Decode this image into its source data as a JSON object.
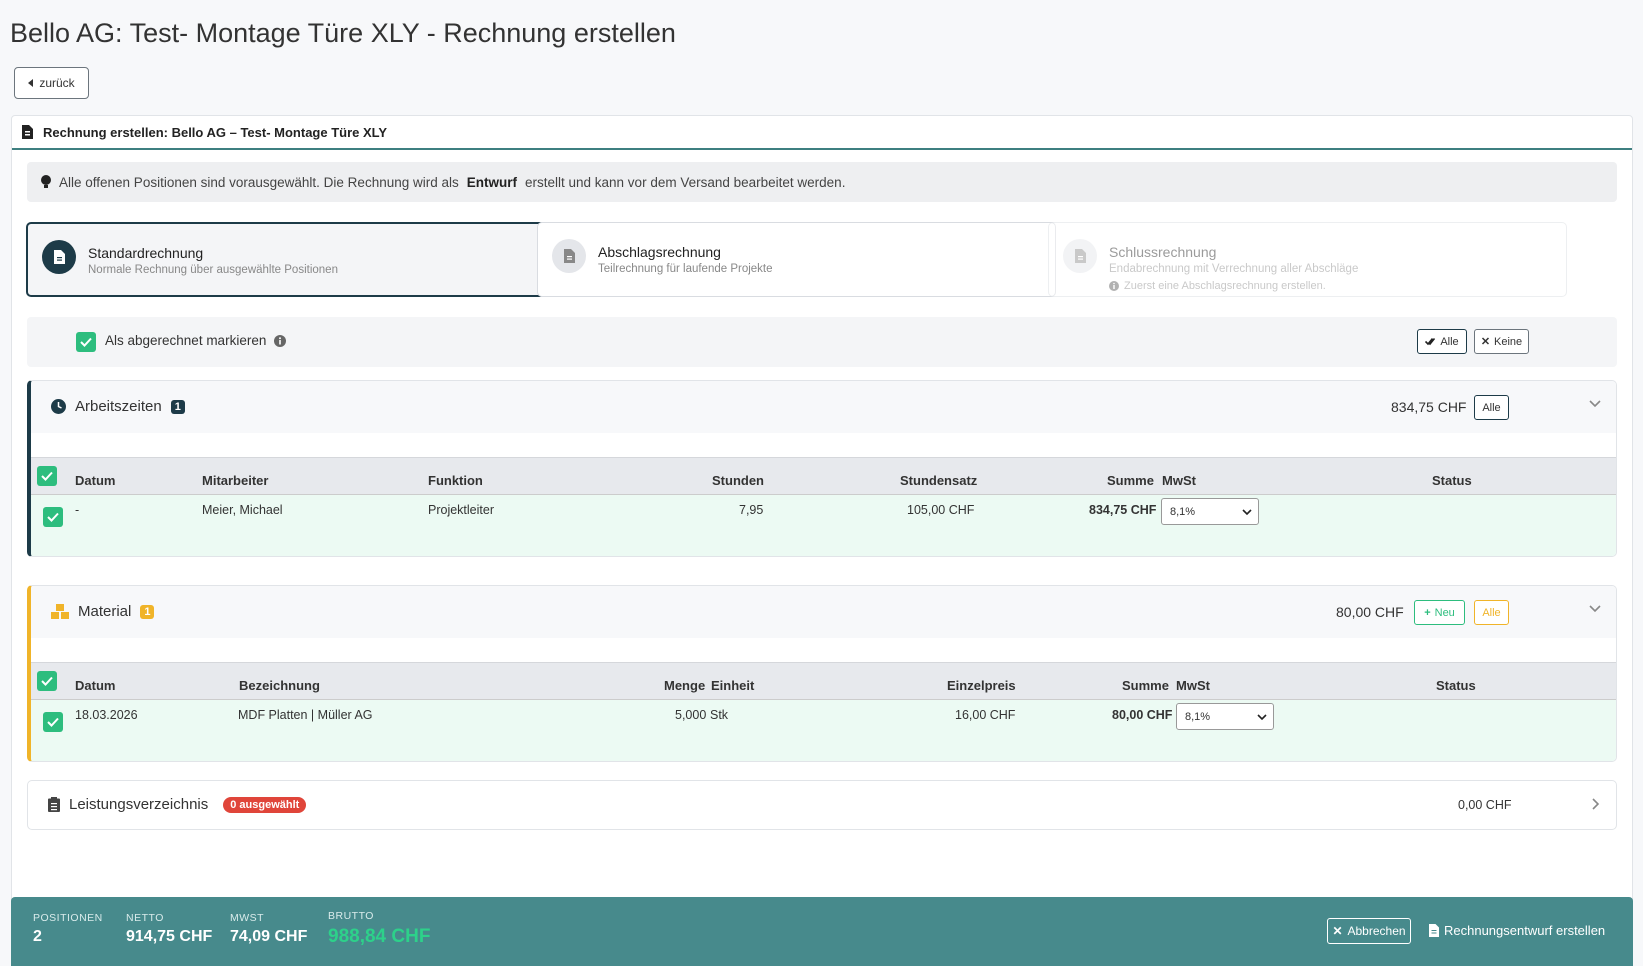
{
  "page": {
    "title": "Bello AG: Test- Montage Türe XLY - Rechnung erstellen",
    "back_label": "zurück"
  },
  "card": {
    "header": "Rechnung erstellen: Bello AG – Test- Montage Türe XLY"
  },
  "info": {
    "text_before": "Alle offenen Positionen sind vorausgewählt. Die Rechnung wird als",
    "bold": "Entwurf",
    "text_after": "erstellt und kann vor dem Versand bearbeitet werden."
  },
  "types": [
    {
      "title": "Standardrechnung",
      "sub": "Normale Rechnung über ausgewählte Positionen"
    },
    {
      "title": "Abschlagsrechnung",
      "sub": "Teilrechnung für laufende Projekte"
    },
    {
      "title": "Schlussrechnung",
      "sub": "Endabrechnung mit Verrechnung aller Abschläge",
      "note": "Zuerst eine Abschlagsrechnung erstellen."
    }
  ],
  "mark": {
    "label": "Als abgerechnet markieren",
    "all_label": "Alle",
    "none_label": "Keine"
  },
  "arbeitszeiten": {
    "title": "Arbeitszeiten",
    "badge": "1",
    "sum": "834,75 CHF",
    "all_label": "Alle",
    "columns": {
      "datum": "Datum",
      "mitarbeiter": "Mitarbeiter",
      "funktion": "Funktion",
      "stunden": "Stunden",
      "stundensatz": "Stundensatz",
      "summe": "Summe",
      "mwst": "MwSt",
      "status": "Status"
    },
    "row": {
      "datum": "-",
      "mitarbeiter": "Meier, Michael",
      "funktion": "Projektleiter",
      "stunden": "7,95",
      "stundensatz": "105,00 CHF",
      "summe": "834,75 CHF",
      "mwst": "8,1%"
    }
  },
  "material": {
    "title": "Material",
    "badge": "1",
    "sum": "80,00 CHF",
    "new_label": "Neu",
    "all_label": "Alle",
    "columns": {
      "datum": "Datum",
      "bezeichnung": "Bezeichnung",
      "menge": "Menge",
      "einheit": "Einheit",
      "einzelpreis": "Einzelpreis",
      "summe": "Summe",
      "mwst": "MwSt",
      "status": "Status"
    },
    "row": {
      "datum": "18.03.2026",
      "bezeichnung": "MDF Platten | Müller AG",
      "menge": "5,000",
      "einheit": "Stk",
      "einzelpreis": "16,00 CHF",
      "summe": "80,00 CHF",
      "mwst": "8,1%"
    }
  },
  "leistung": {
    "title": "Leistungsverzeichnis",
    "badge": "0 ausgewählt",
    "sum": "0,00 CHF"
  },
  "footer": {
    "positionen_label": "POSITIONEN",
    "positionen": "2",
    "netto_label": "NETTO",
    "netto": "914,75 CHF",
    "mwst_label": "MWST",
    "mwst": "74,09 CHF",
    "brutto_label": "BRUTTO",
    "brutto": "988,84 CHF",
    "cancel_label": "Abbrechen",
    "create_label": "Rechnungsentwurf erstellen"
  },
  "colors": {
    "teal": "#478a8c",
    "navy": "#1d3b48",
    "green": "#2dbd7e",
    "amber": "#f0b429",
    "red": "#e0453a"
  }
}
